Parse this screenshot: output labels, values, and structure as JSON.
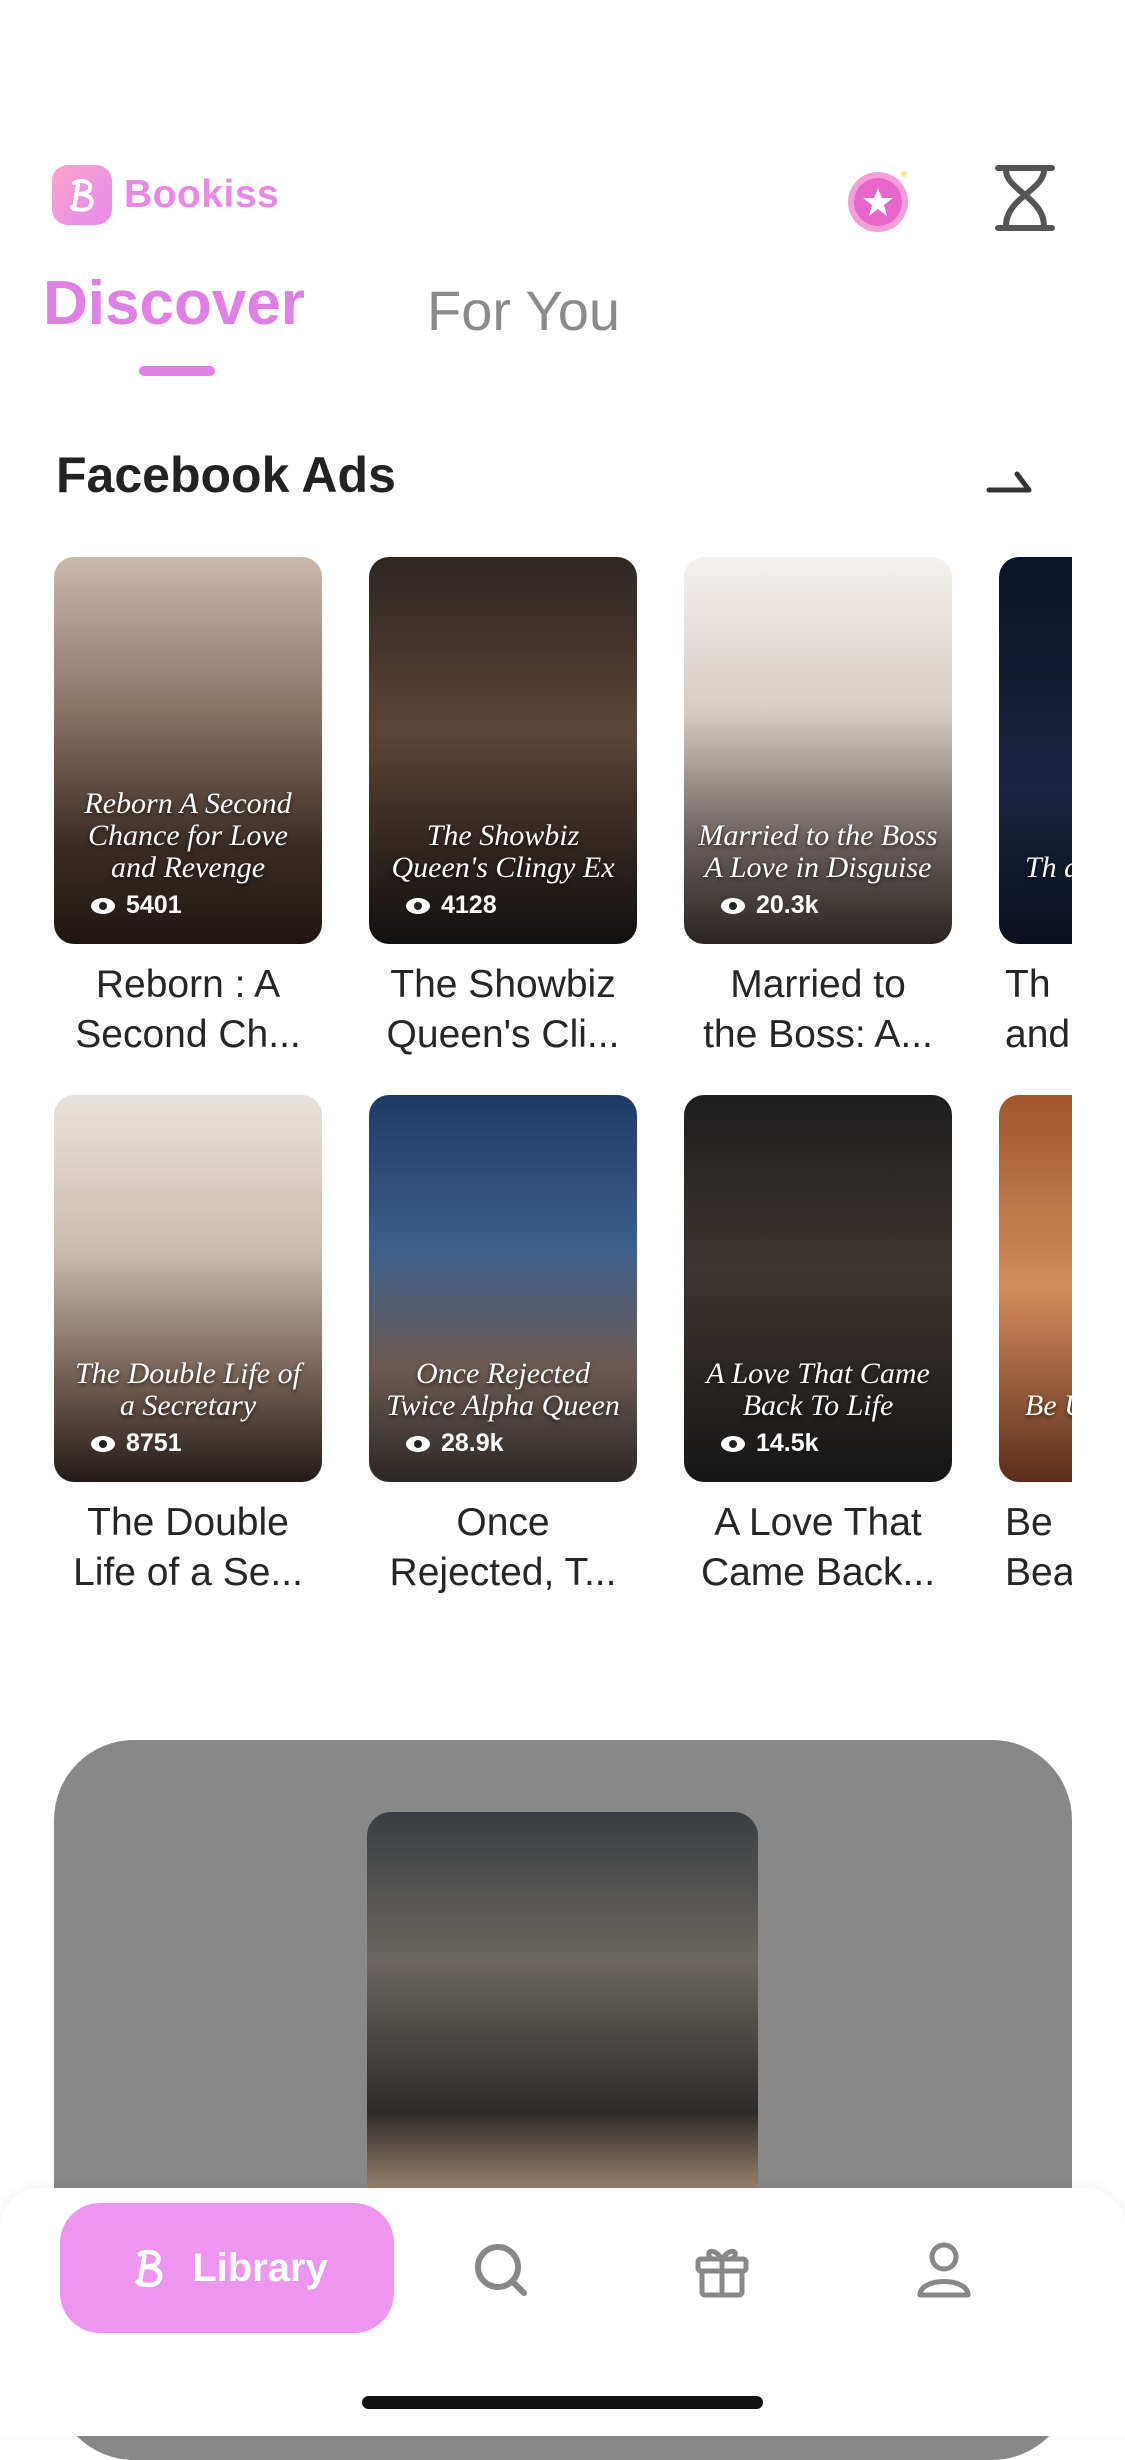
{
  "header": {
    "app_name": "Bookiss",
    "icons": [
      "premium-star-icon",
      "hourglass-icon"
    ]
  },
  "tabs": [
    {
      "label": "Discover",
      "active": true
    },
    {
      "label": "For You",
      "active": false
    }
  ],
  "section": {
    "title": "Facebook Ads",
    "more_icon": "arrow-right-icon"
  },
  "books": [
    {
      "cover_text": "Reborn\nA Second Chance\nfor Love and Revenge",
      "views": "5401",
      "title": "Reborn : A\nSecond Ch..."
    },
    {
      "cover_text": "The\nShowbiz Queen's\nClingy Ex",
      "views": "4128",
      "title": "The Showbiz\nQueen's Cli..."
    },
    {
      "cover_text": "Married to the Boss\nA Love in Disguise",
      "views": "20.3k",
      "title": "Married to\nthe Boss: A..."
    },
    {
      "cover_text": "Th\nand",
      "views": "",
      "title": "Th\nand"
    },
    {
      "cover_text": "The Double Life\nof a Secretary",
      "views": "8751",
      "title": "The Double\nLife of a Se..."
    },
    {
      "cover_text": "Once Rejected\nTwice Alpha Queen",
      "views": "28.9k",
      "title": "Once\nRejected, T..."
    },
    {
      "cover_text": "A Love\nThat Came Back\nTo Life",
      "views": "14.5k",
      "title": "A Love That\nCame Back..."
    },
    {
      "cover_text": "Be\nUn\nTalon",
      "views": "",
      "title": "Be\nBea"
    }
  ],
  "bottom_nav": {
    "library_label": "Library",
    "items": [
      "library-icon",
      "search-icon",
      "gift-icon",
      "profile-icon"
    ]
  },
  "colors": {
    "accent": "#e07fe4",
    "library_button": "#ec96f0",
    "featured_card": "#888888"
  }
}
